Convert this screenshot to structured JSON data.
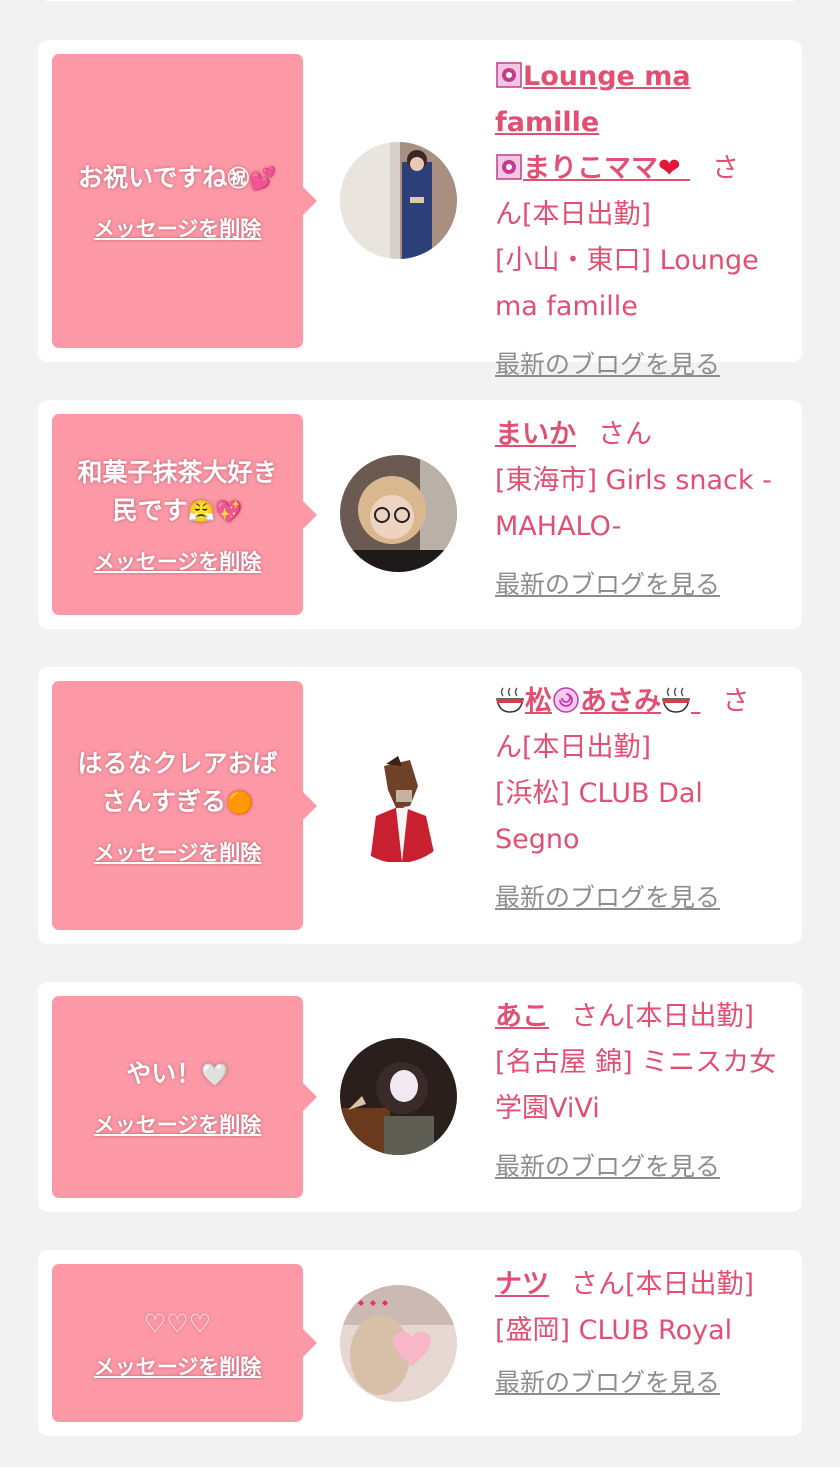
{
  "cards": [
    {
      "message": "お祝いですね",
      "message_emoji": "㊗💕",
      "delete_label": "メッセージを削除",
      "name_line1": "Lounge ma famille",
      "name_line2": "まりこママ",
      "name_suffix": "❤",
      "san": "さ",
      "status_line": "ん[本日出勤]",
      "shop_line1": "[小山・東口] Lounge",
      "shop_line2": "ma famille",
      "blog_label": "最新のブログを見る"
    },
    {
      "message_line1": "和菓子抹茶大好き",
      "message_line2": "民です",
      "message_emoji": "😤💖",
      "delete_label": "メッセージを削除",
      "name": "まいか",
      "san": "さん",
      "shop_line1": "[東海市] Girls snack -",
      "shop_line2": "MAHALO-",
      "blog_label": "最新のブログを見る"
    },
    {
      "message_line1": "はるなクレアおば",
      "message_line2": "さんすぎる",
      "message_emoji": "🟠",
      "delete_label": "メッセージを削除",
      "name_part1": "松",
      "name_part2": "あさみ",
      "san": "さ",
      "status_line": "ん[本日出勤]",
      "shop_line1": "[浜松] CLUB Dal",
      "shop_line2": "Segno",
      "blog_label": "最新のブログを見る"
    },
    {
      "message": "やい！",
      "message_emoji": "🤍",
      "delete_label": "メッセージを削除",
      "name": "あこ",
      "san": "さん[本日出勤]",
      "shop_line1": "[名古屋 錦] ミニスカ女",
      "shop_line2": "学園ViVi",
      "blog_label": "最新のブログを見る"
    },
    {
      "message": "♡♡♡",
      "delete_label": "メッセージを削除",
      "name": "ナツ",
      "san": "さん[本日出勤]",
      "shop_line1": "[盛岡] CLUB Royal",
      "blog_label": "最新のブログを見る"
    }
  ],
  "colors": {
    "bubble": "#fd99a6",
    "accent_text": "#e34f72",
    "muted_link": "#8d8d8d",
    "background": "#f2f2f2"
  },
  "icons": [
    "flower-icon",
    "heart-icon",
    "ramen-bowl-icon",
    "naruto-icon"
  ]
}
